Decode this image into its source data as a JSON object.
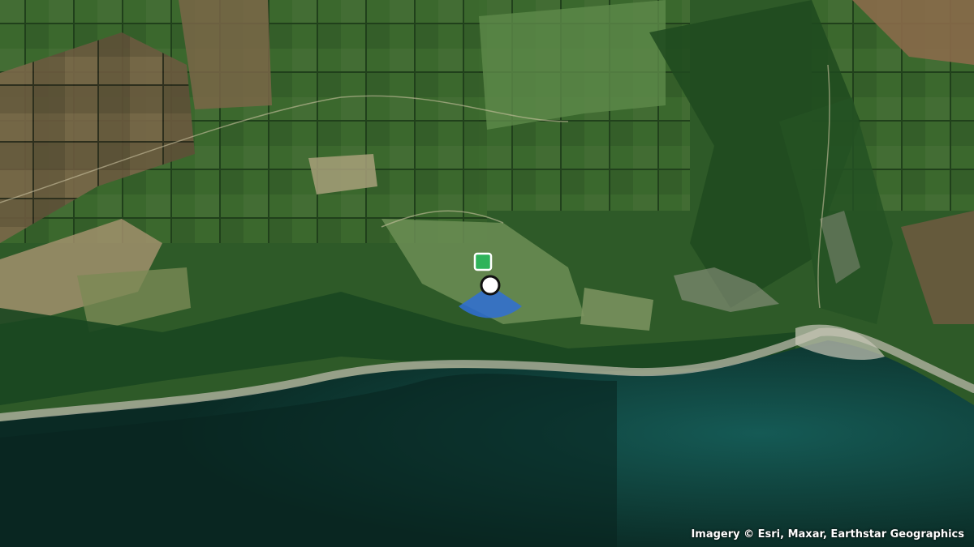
{
  "attribution": "Imagery © Esri, Maxar, Earthstar Geographics",
  "markers": [
    {
      "type": "pin",
      "icon": "square-marker-icon",
      "color": "#2fb35a"
    },
    {
      "type": "location",
      "icon": "location-dot-icon",
      "color": "#ffffff"
    },
    {
      "type": "view-cone",
      "icon": "view-direction-cone-icon",
      "color": "#2f6fd6"
    }
  ],
  "colors": {
    "sea": "#0b2a22",
    "sea_shallow": "#0f4a42",
    "land": "#2f5a2a",
    "shore": "#a9a89a",
    "marker_green": "#2fb35a",
    "cone_blue": "#2f6fd6"
  }
}
